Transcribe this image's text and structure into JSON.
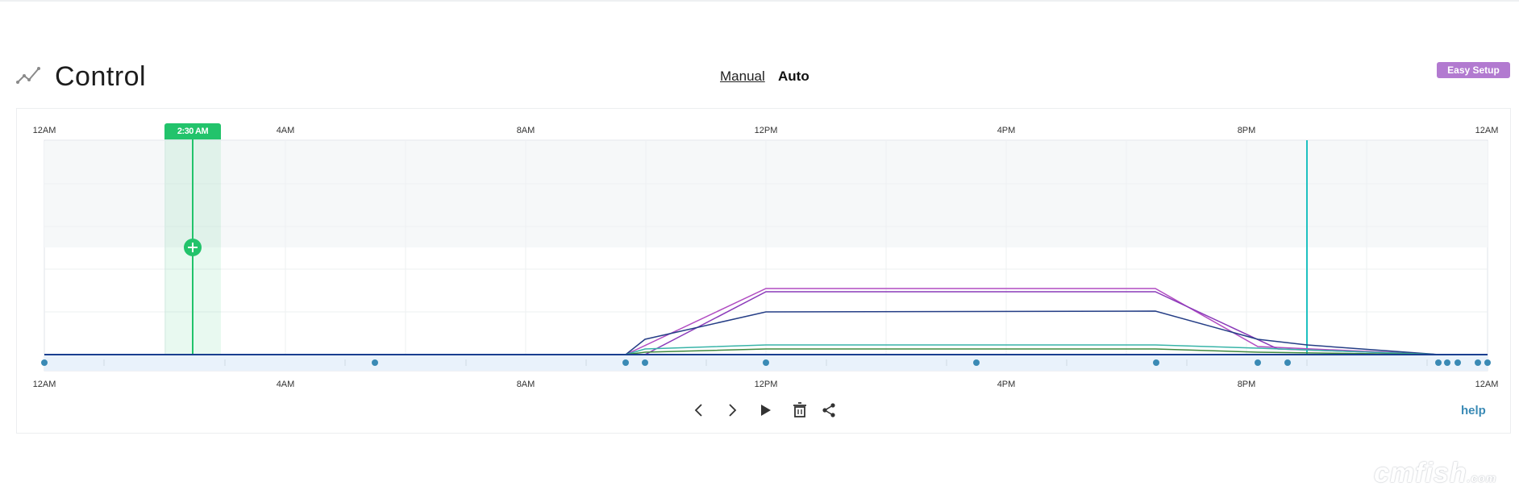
{
  "header": {
    "title": "Control",
    "icon": "line-chart-icon",
    "modes": {
      "manual": "Manual",
      "auto": "Auto"
    },
    "easy_setup": "Easy Setup",
    "accent": "#b27ad0"
  },
  "timeline": {
    "top_ticks": [
      "12AM",
      "4AM",
      "8AM",
      "12PM",
      "4PM",
      "8PM",
      "12AM"
    ],
    "bottom_ticks": [
      "12AM",
      "4AM",
      "8AM",
      "12PM",
      "4PM",
      "8PM",
      "12AM"
    ],
    "selected_time": "2:30 AM",
    "selection_color": "#22c36b",
    "current_time_color": "#1ec1c1",
    "point_color": "#3a8ab5"
  },
  "controls": {
    "prev": "chevron-left-icon",
    "next": "chevron-right-icon",
    "play": "play-icon",
    "delete": "trash-icon",
    "share": "share-icon",
    "help": "help"
  },
  "watermark": {
    "text": "cmfish",
    "suffix": ".com"
  }
}
